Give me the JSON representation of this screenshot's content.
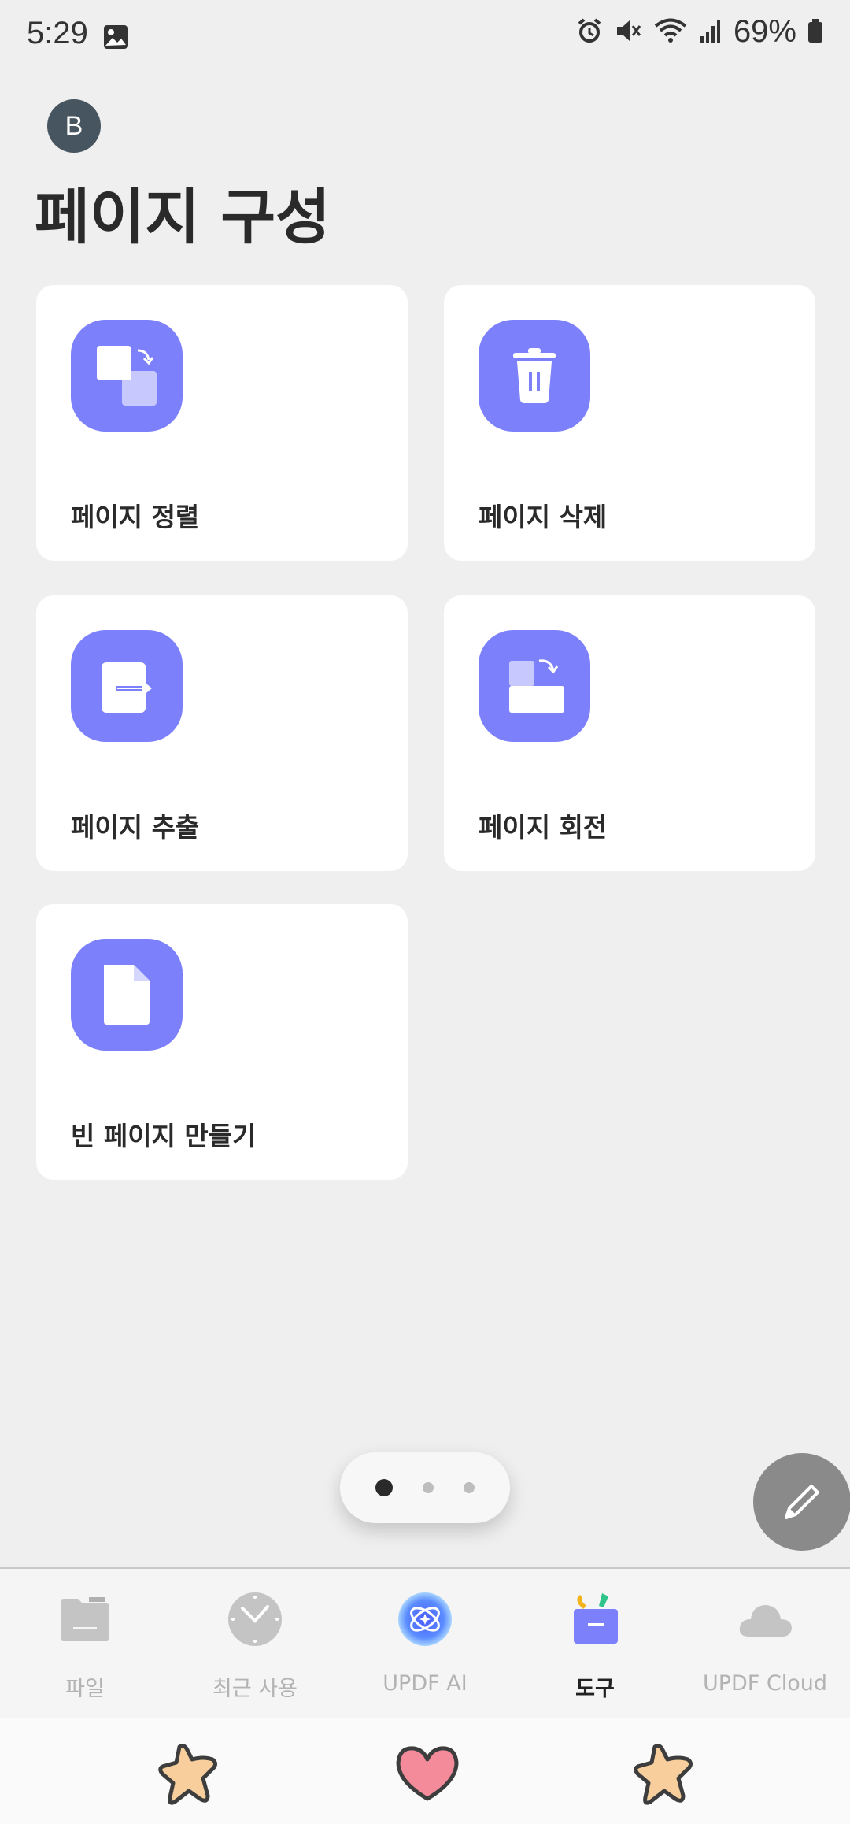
{
  "status_bar": {
    "time": "5:29",
    "battery": "69%"
  },
  "header": {
    "avatar_initial": "B",
    "title": "페이지 구성"
  },
  "tools": [
    {
      "label": "페이지 정렬"
    },
    {
      "label": "페이지 삭제"
    },
    {
      "label": "페이지 추출"
    },
    {
      "label": "페이지 회전"
    },
    {
      "label": "빈 페이지 만들기"
    }
  ],
  "pager": {
    "current_page": 1,
    "total_pages": 3
  },
  "bottom_nav": {
    "items": [
      {
        "label": "파일",
        "icon": "folder-icon"
      },
      {
        "label": "최근 사용",
        "icon": "clock-icon"
      },
      {
        "label": "UPDF AI",
        "icon": "ai-icon"
      },
      {
        "label": "도구",
        "icon": "toolbox-icon",
        "active": true
      },
      {
        "label": "UPDF Cloud",
        "icon": "cloud-icon"
      }
    ]
  },
  "colors": {
    "accent": "#7c80fb",
    "background": "#efefef",
    "card": "#ffffff",
    "fab": "#8a8a8a"
  }
}
